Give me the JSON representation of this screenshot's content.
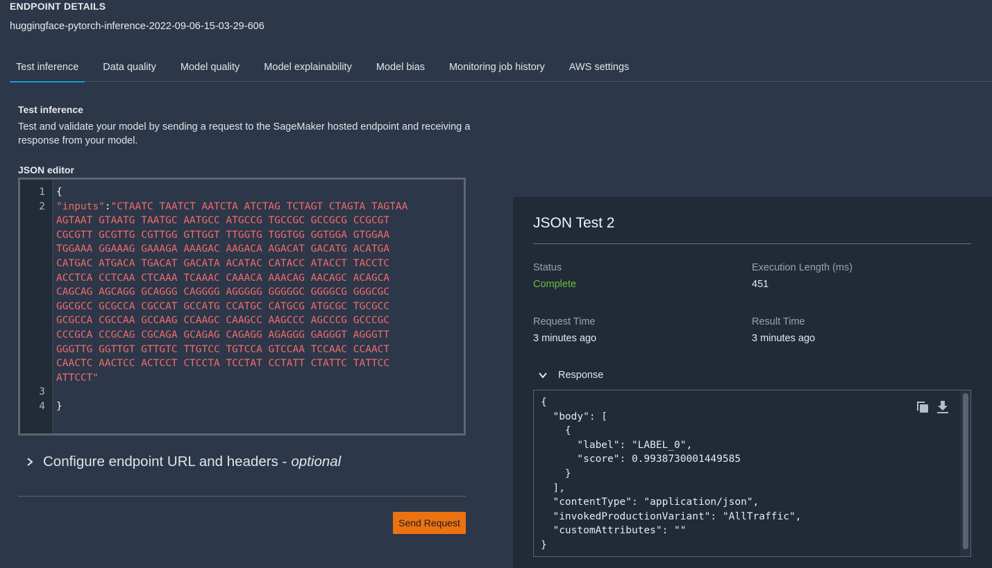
{
  "header": {
    "label": "ENDPOINT DETAILS",
    "endpoint_name": "huggingface-pytorch-inference-2022-09-06-15-03-29-606"
  },
  "tabs": [
    {
      "label": "Test inference",
      "active": true
    },
    {
      "label": "Data quality",
      "active": false
    },
    {
      "label": "Model quality",
      "active": false
    },
    {
      "label": "Model explainability",
      "active": false
    },
    {
      "label": "Model bias",
      "active": false
    },
    {
      "label": "Monitoring job history",
      "active": false
    },
    {
      "label": "AWS settings",
      "active": false
    }
  ],
  "test_inference": {
    "title": "Test inference",
    "description": "Test and validate your model by sending a request to the SageMaker hosted endpoint and receiving a response from your model.",
    "editor_label": "JSON editor",
    "editor": {
      "line_numbers": [
        "1",
        "2",
        "",
        "",
        "",
        "",
        "",
        "",
        "",
        "",
        "",
        "",
        "",
        "",
        "3",
        "4"
      ],
      "open_brace": "{",
      "close_brace": "}",
      "key": "\"inputs\"",
      "colon": ":",
      "value_lines": [
        "\"CTAATC TAATCT AATCTA ATCTAG TCTAGT CTAGTA TAGTAA",
        "AGTAAT GTAATG TAATGC AATGCC ATGCCG TGCCGC GCCGCG CCGCGT",
        "CGCGTT GCGTTG CGTTGG GTTGGT TTGGTG TGGTGG GGTGGA GTGGAA",
        "TGGAAA GGAAAG GAAAGA AAAGAC AAGACA AGACAT GACATG ACATGA",
        "CATGAC ATGACA TGACAT GACATA ACATAC CATACC ATACCT TACCTC",
        "ACCTCA CCTCAA CTCAAA TCAAAC CAAACA AAACAG AACAGC ACAGCA",
        "CAGCAG AGCAGG GCAGGG CAGGGG AGGGGG GGGGGC GGGGCG GGGCGC",
        "GGCGCC GCGCCA CGCCAT GCCATG CCATGC CATGCG ATGCGC TGCGCC",
        "GCGCCA CGCCAA GCCAAG CCAAGC CAAGCC AAGCCC AGCCCG GCCCGC",
        "CCCGCA CCGCAG CGCAGA GCAGAG CAGAGG AGAGGG GAGGGT AGGGTT",
        "GGGTTG GGTTGT GTTGTC TTGTCC TGTCCA GTCCAA TCCAAC CCAACT",
        "CAACTC AACTCC ACTCCT CTCCTA TCCTAT CCTATT CTATTC TATTCC",
        "ATTCCT\""
      ]
    },
    "configure": {
      "label": "Configure endpoint URL and headers -",
      "optional": "optional"
    },
    "send_button": "Send Request"
  },
  "result": {
    "title": "JSON Test 2",
    "status_label": "Status",
    "status_value": "Complete",
    "execution_label": "Execution Length (ms)",
    "execution_value": "451",
    "request_time_label": "Request Time",
    "request_time_value": "3 minutes ago",
    "result_time_label": "Result Time",
    "result_time_value": "3 minutes ago",
    "response_label": "Response",
    "response_lines": [
      "{",
      "  \"body\": [",
      "    {",
      "      \"label\": \"LABEL_0\",",
      "      \"score\": 0.9938730001449585",
      "    }",
      "  ],",
      "  \"contentType\": \"application/json\",",
      "  \"invokedProductionVariant\": \"AllTraffic\",",
      "  \"customAttributes\": \"\"",
      "}"
    ],
    "copy_icon": "copy-icon",
    "download_icon": "download-icon"
  },
  "colors": {
    "accent_tab": "#1a9bd7",
    "button": "#ec7211",
    "status_complete": "#6fbf3a",
    "json_string": "#f26b6b"
  }
}
